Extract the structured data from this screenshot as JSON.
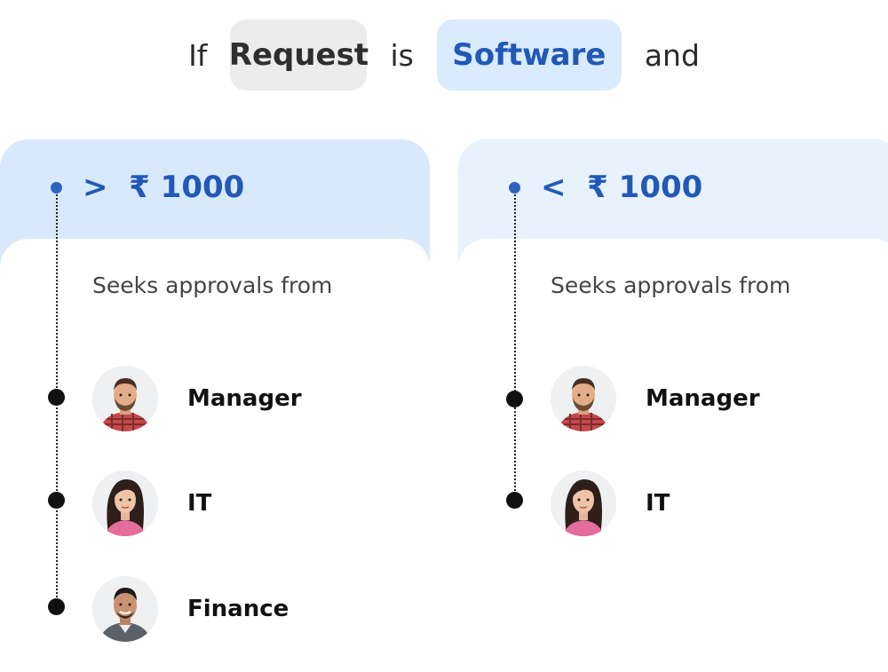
{
  "condition": {
    "prefix": "If",
    "field": "Request",
    "operator": "is",
    "value": "Software",
    "suffix": "and"
  },
  "rules": [
    {
      "threshold": ">  ₹ 1000",
      "subtitle": "Seeks approvals from",
      "approvers": [
        {
          "label": "Manager",
          "avatar": "man-beard-avatar"
        },
        {
          "label": "IT",
          "avatar": "woman-long-hair-avatar"
        },
        {
          "label": "Finance",
          "avatar": "man-smiling-avatar"
        }
      ]
    },
    {
      "threshold": "<  ₹ 1000",
      "subtitle": "Seeks approvals from",
      "approvers": [
        {
          "label": "Manager",
          "avatar": "man-beard-avatar"
        },
        {
          "label": "IT",
          "avatar": "woman-long-hair-avatar"
        }
      ]
    }
  ],
  "colors": {
    "accent": "#2259b8",
    "chip_grey": "#ececec",
    "chip_blue": "#d9ebfc",
    "card_header_left": "#d8e9fb",
    "card_header_right": "#e7f2fd"
  }
}
